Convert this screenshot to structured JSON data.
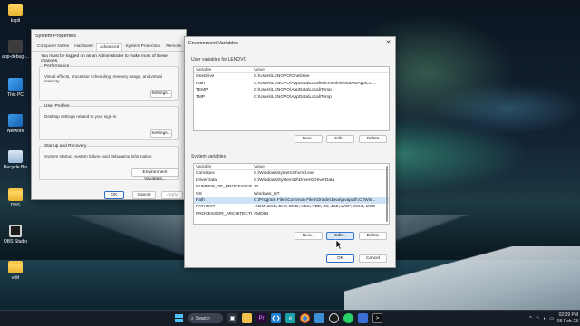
{
  "desktop": {
    "icons": [
      {
        "label": "kapil",
        "icon": "user-folder-icon"
      },
      {
        "label": "app-debug-...",
        "icon": "file-icon"
      },
      {
        "label": "This PC",
        "icon": "this-pc-icon"
      },
      {
        "label": "Network",
        "icon": "network-icon"
      },
      {
        "label": "Recycle Bin",
        "icon": "recycle-bin-icon"
      },
      {
        "label": "DBS",
        "icon": "folder-icon"
      },
      {
        "label": "OBS Studio",
        "icon": "obs-icon"
      },
      {
        "label": "edit",
        "icon": "folder-icon"
      }
    ]
  },
  "system_properties": {
    "title": "System Properties",
    "tabs": [
      "Computer Name",
      "Hardware",
      "Advanced",
      "System Protection",
      "Remote"
    ],
    "active_tab": "Advanced",
    "note": "You must be logged on as an Administrator to make most of these changes.",
    "performance": {
      "title": "Performance",
      "text": "Visual effects, processor scheduling, memory usage, and virtual memory",
      "button": "Settings..."
    },
    "user_profiles": {
      "title": "User Profiles",
      "text": "Desktop settings related to your sign-in",
      "button": "Settings..."
    },
    "startup": {
      "title": "Startup and Recovery",
      "text": "System startup, system failure, and debugging information",
      "button": "Settings..."
    },
    "env_button": "Environment Variables...",
    "ok": "OK",
    "cancel": "Cancel",
    "apply": "Apply"
  },
  "env_vars": {
    "title": "Environment Variables",
    "user_section": "User variables for LENOVO",
    "columns": [
      "Variable",
      "Value"
    ],
    "user_rows": [
      {
        "variable": "OneDrive",
        "value": "C:\\Users\\LENOVO\\OneDrive"
      },
      {
        "variable": "Path",
        "value": "C:\\Users\\LENOVO\\AppData\\Local\\Microsoft\\WindowsApps;C:..."
      },
      {
        "variable": "TEMP",
        "value": "C:\\Users\\LENOVO\\AppData\\Local\\Temp"
      },
      {
        "variable": "TMP",
        "value": "C:\\Users\\LENOVO\\AppData\\Local\\Temp"
      }
    ],
    "user_buttons": {
      "new": "New...",
      "edit": "Edit...",
      "delete": "Delete"
    },
    "system_section": "System variables",
    "system_rows": [
      {
        "variable": "ComSpec",
        "value": "C:\\Windows\\system32\\cmd.exe"
      },
      {
        "variable": "DriverData",
        "value": "C:\\Windows\\System32\\Drivers\\DriverData"
      },
      {
        "variable": "NUMBER_OF_PROCESSORS",
        "value": "12"
      },
      {
        "variable": "OS",
        "value": "Windows_NT"
      },
      {
        "variable": "Path",
        "value": "C:\\Program Files\\Common Files\\Oracle\\Java\\javapath;C:\\Win..."
      },
      {
        "variable": "PATHEXT",
        "value": ".COM;.EXE;.BAT;.CMD;.VBS;.VBE;.JS;.JSE;.WSF;.WSH;.MSC"
      },
      {
        "variable": "PROCESSOR_ARCHITECTU...",
        "value": "AMD64"
      }
    ],
    "selected_system_variable": "Path",
    "system_buttons": {
      "new": "New...",
      "edit": "Edit...",
      "delete": "Delete"
    },
    "ok": "OK",
    "cancel": "Cancel"
  },
  "taskbar": {
    "search_label": "Search",
    "apps": [
      "windows-start-icon",
      "search",
      "task-view-icon",
      "file-explorer-icon",
      "premiere-icon",
      "vscode-icon",
      "edge-icon",
      "chrome-icon",
      "photos-icon",
      "obs-icon",
      "whatsapp-icon",
      "store-icon",
      "terminal-icon"
    ],
    "time": "02:09 PM",
    "date": "06-Feb-23"
  },
  "colors": {
    "accent": "#2b6cc4",
    "selection": "#cfe3f8",
    "taskbar": "#1a2028"
  }
}
